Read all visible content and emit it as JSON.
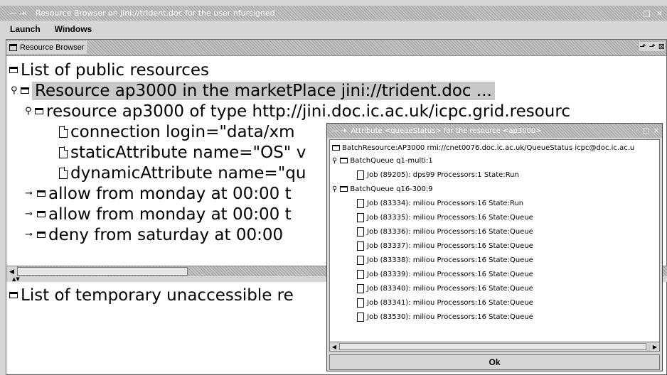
{
  "window": {
    "title": "Resource Browser on jini://trident.doc for the user nfursigned",
    "controls": [
      "·",
      "□",
      "×"
    ]
  },
  "menubar": {
    "items": [
      "Launch",
      "Windows"
    ]
  },
  "browser_frame": {
    "title": "Resource Browser",
    "controls": [
      "⬏",
      "⬏",
      "⊠"
    ]
  },
  "public_tree": {
    "root": "List of public resources",
    "resource": "Resource ap3000 in the marketPlace jini://trident.doc ...",
    "resource_type": "resource ap3000 of type http://jini.doc.ic.ac.uk/icpc.grid.resourc",
    "connection": "connection login=\"data/xm",
    "static_attr": "staticAttribute name=\"OS\" v",
    "dynamic_attr": "dynamicAttribute name=\"qu",
    "rule1": "allow from monday at 00:00 t",
    "rule2": "allow from monday at 00:00 t",
    "rule3": "deny from saturday at 00:00 "
  },
  "temp_tree": {
    "root": "List of temporary unaccessible re"
  },
  "dialog": {
    "title": "Attribute <queueStatus> for the resource <ap3000>",
    "controls": [
      "·",
      "□",
      "×"
    ],
    "root": "BatchResource:AP3000 rmi://cnet0076.doc.ic.ac.uk/QueueStatus icpc@doc.ic.ac.u",
    "queue1": "BatchQueue q1-multi:1",
    "queue1_jobs": [
      "Job (89205): dps99 Processors:1 State:Run"
    ],
    "queue2": "BatchQueue q16-300:9",
    "queue2_jobs": [
      "Job (83334): miliou Processors:16 State:Run",
      "Job (83335): miliou Processors:16 State:Queue",
      "Job (83336): miliou Processors:16 State:Queue",
      "Job (83337): miliou Processors:16 State:Queue",
      "Job (83338): miliou Processors:16 State:Queue",
      "Job (83339): miliou Processors:16 State:Queue",
      "Job (83340): miliou Processors:16 State:Queue",
      "Job (83341): miliou Processors:16 State:Queue",
      "Job (83530): miliou Processors:16 State:Queue"
    ],
    "ok_label": "Ok"
  }
}
